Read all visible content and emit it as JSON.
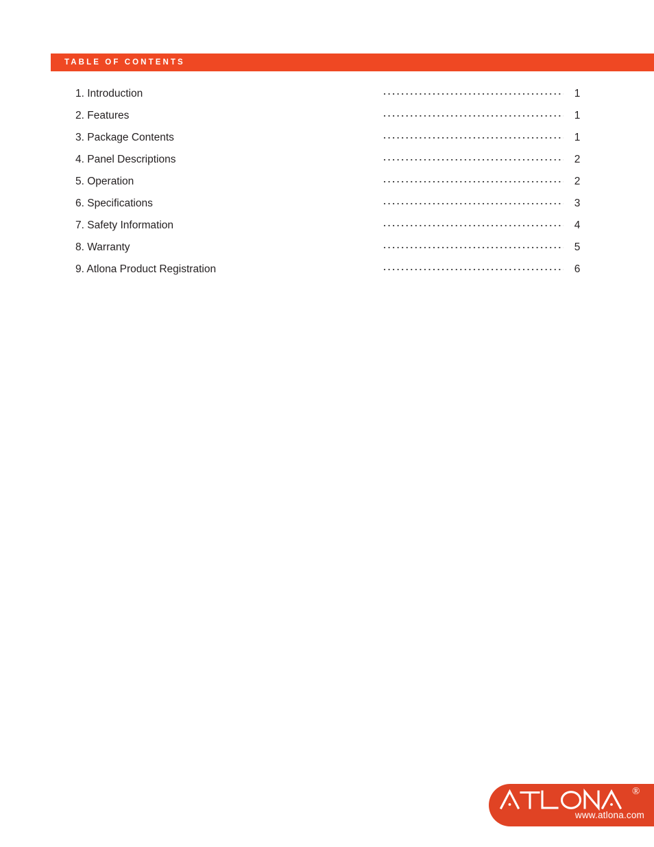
{
  "page": {
    "background_color": "#ffffff",
    "accent_color": "#ef4823",
    "text_color": "#231f20"
  },
  "section_header": {
    "title": "TABLE OF CONTENTS",
    "background_color": "#ef4823",
    "text_color": "#ffffff"
  },
  "toc": {
    "leader_style": "dotted",
    "entries": [
      {
        "label": "1. Introduction",
        "page": "1"
      },
      {
        "label": "2. Features",
        "page": "1"
      },
      {
        "label": "3. Package Contents",
        "page": "1"
      },
      {
        "label": "4. Panel Descriptions",
        "page": "2"
      },
      {
        "label": "5. Operation",
        "page": "2"
      },
      {
        "label": "6. Specifications",
        "page": "3"
      },
      {
        "label": "7. Safety Information",
        "page": "4"
      },
      {
        "label": "8. Warranty",
        "page": "5"
      },
      {
        "label": "9. Atlona Product Registration",
        "page": "6"
      }
    ]
  },
  "logo": {
    "wordmark": "ATLONA",
    "registered_mark": "®",
    "url": "www.atlona.com",
    "background_color": "#e04324",
    "text_color": "#ffffff"
  }
}
